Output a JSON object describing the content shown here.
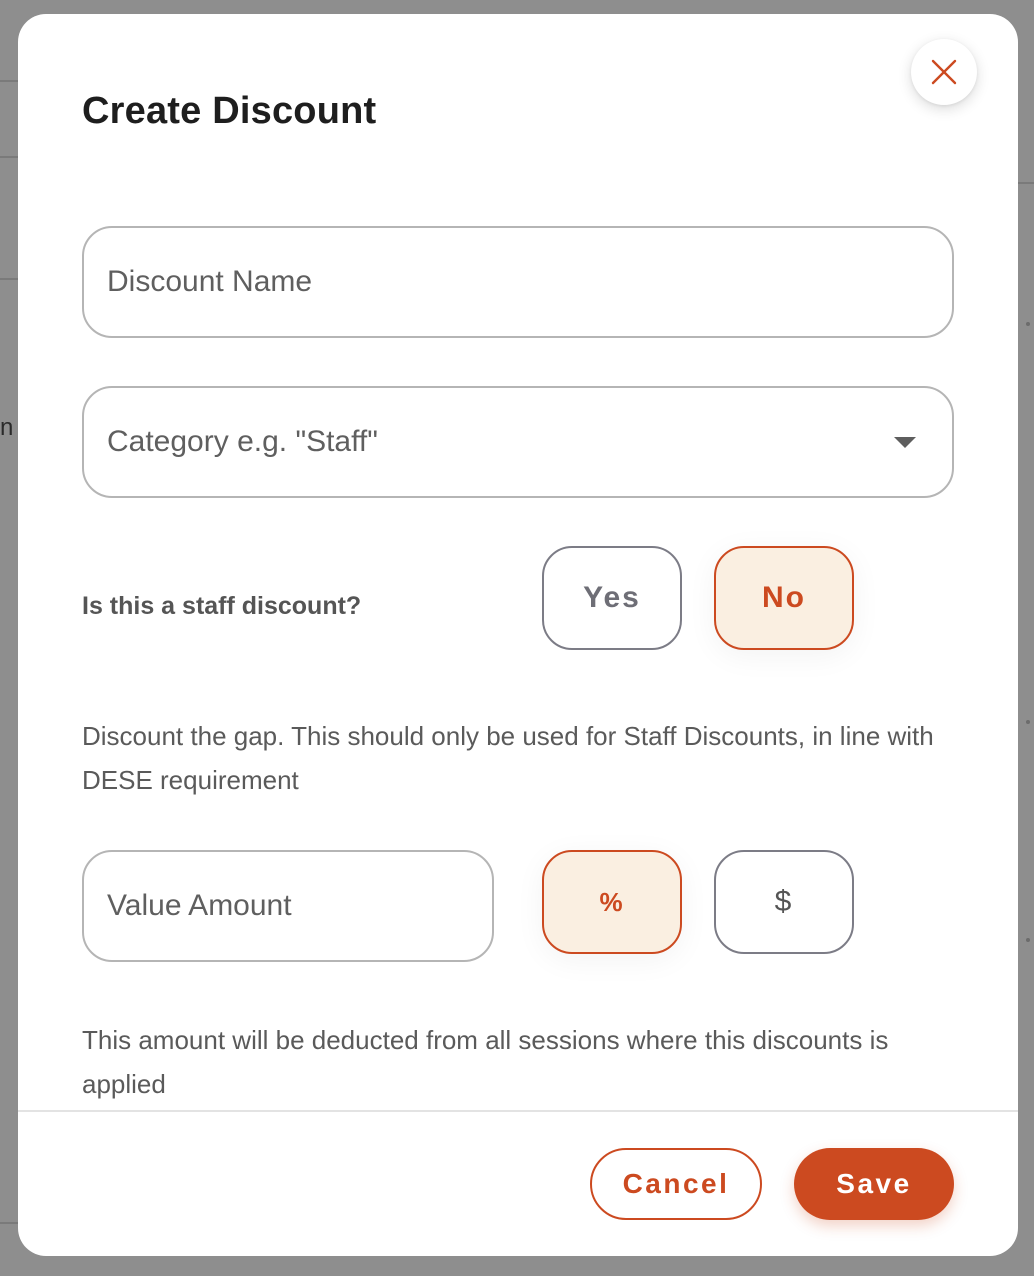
{
  "modal": {
    "title": "Create Discount",
    "close_icon": "close-icon"
  },
  "form": {
    "discount_name": {
      "placeholder": "Discount Name",
      "value": ""
    },
    "category": {
      "placeholder": "Category e.g. \"Staff\"",
      "value": "",
      "icon": "chevron-down-icon"
    },
    "staff_discount": {
      "label": "Is this a staff discount?",
      "yes_label": "Yes",
      "no_label": "No",
      "selected": "No"
    },
    "gap_help": "Discount the gap. This should only be used for Staff Discounts, in line with DESE requirement",
    "value_amount": {
      "placeholder": "Value Amount",
      "value": ""
    },
    "value_type": {
      "percent_label": "%",
      "dollar_label": "$",
      "selected": "%"
    },
    "amount_help": "This amount will be deducted from all sessions where this discounts is applied"
  },
  "footer": {
    "cancel_label": "Cancel",
    "save_label": "Save"
  },
  "background": {
    "fragment_text": "n"
  },
  "colors": {
    "accent": "#cc4a20",
    "selected_fill": "#faefe1",
    "overlay": "#8e8e8e"
  }
}
